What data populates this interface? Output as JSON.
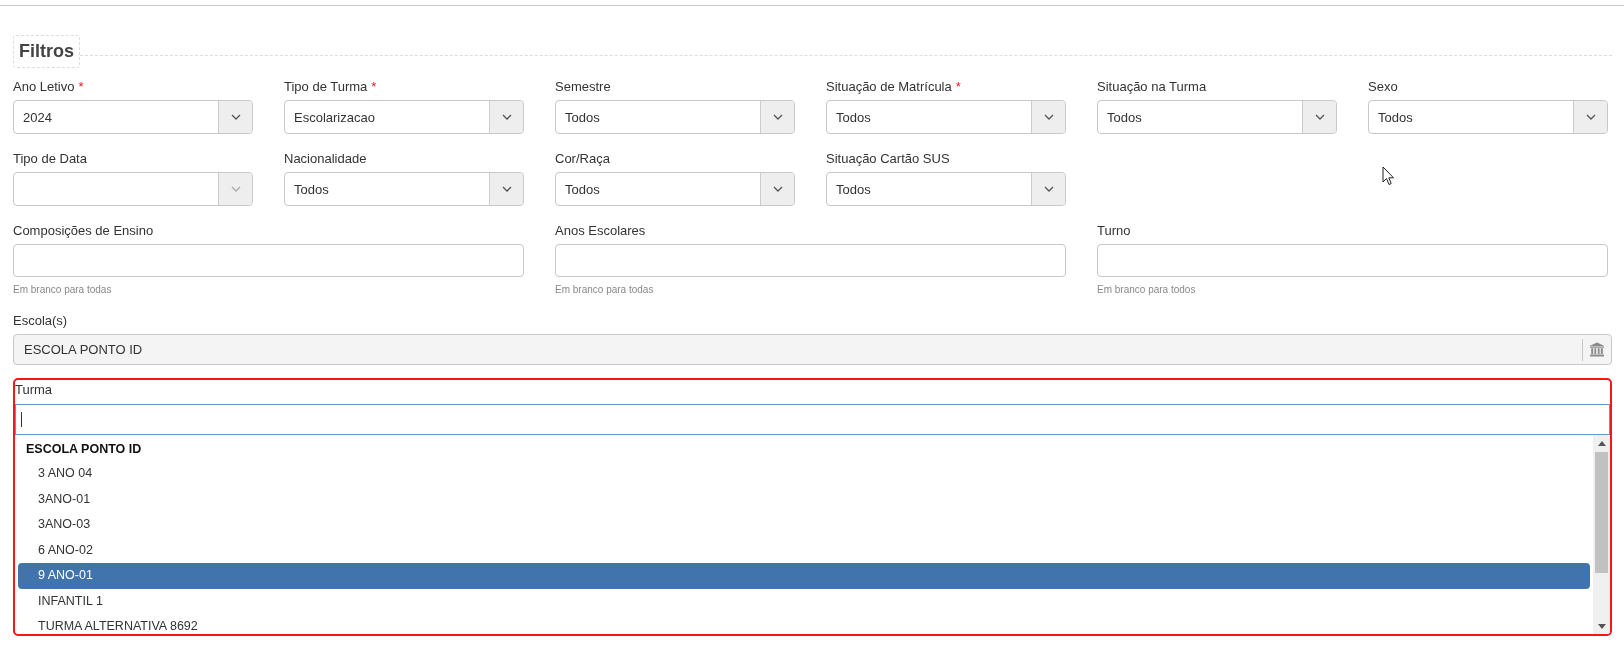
{
  "legend": "Filtros",
  "filter_rows": [
    [
      {
        "kind": "select",
        "label": "Ano Letivo",
        "marker": "*",
        "value": "2024",
        "disabled": false
      },
      {
        "kind": "select",
        "label": "Tipo de Turma",
        "marker": "*",
        "value": "Escolarizacao",
        "disabled": false
      },
      {
        "kind": "select",
        "label": "Semestre",
        "value": "Todos",
        "disabled": false
      },
      {
        "kind": "select",
        "label": "Situação de Matrícula",
        "marker": "*",
        "value": "Todos",
        "disabled": false
      },
      {
        "kind": "select",
        "label": "Situação na Turma",
        "value": "Todos",
        "disabled": false
      },
      {
        "kind": "select",
        "label": "Sexo",
        "value": "Todos",
        "disabled": false
      }
    ],
    [
      {
        "kind": "select",
        "label": "Tipo de Data",
        "disabled": true
      },
      {
        "kind": "select",
        "label": "Nacionalidade",
        "value": "Todos",
        "disabled": false
      },
      {
        "kind": "select",
        "label": "Cor/Raça",
        "value": "Todos",
        "disabled": false
      },
      {
        "kind": "select",
        "label": "Situação Cartão SUS",
        "value": "Todos",
        "disabled": false
      }
    ],
    [
      {
        "kind": "multi",
        "label": "Composições de Ensino",
        "hint": "Em branco para todas"
      },
      {
        "kind": "multi",
        "label": "Anos Escolares",
        "hint": "Em branco para todas"
      },
      {
        "kind": "multi",
        "label": "Turno",
        "hint": "Em branco para todos"
      }
    ]
  ],
  "school": {
    "label": "Escola(s)",
    "value": "ESCOLA PONTO ID"
  },
  "turma": {
    "label": "Turma",
    "group": "ESCOLA PONTO ID",
    "options": [
      {
        "label": "3 ANO 04",
        "selected": false
      },
      {
        "label": "3ANO-01",
        "selected": false
      },
      {
        "label": "3ANO-03",
        "selected": false
      },
      {
        "label": "6 ANO-02",
        "selected": false
      },
      {
        "label": "9 ANO-01",
        "selected": true
      },
      {
        "label": "INFANTIL 1",
        "selected": false
      },
      {
        "label": "TURMA ALTERNATIVA 8692",
        "selected": false
      }
    ]
  }
}
